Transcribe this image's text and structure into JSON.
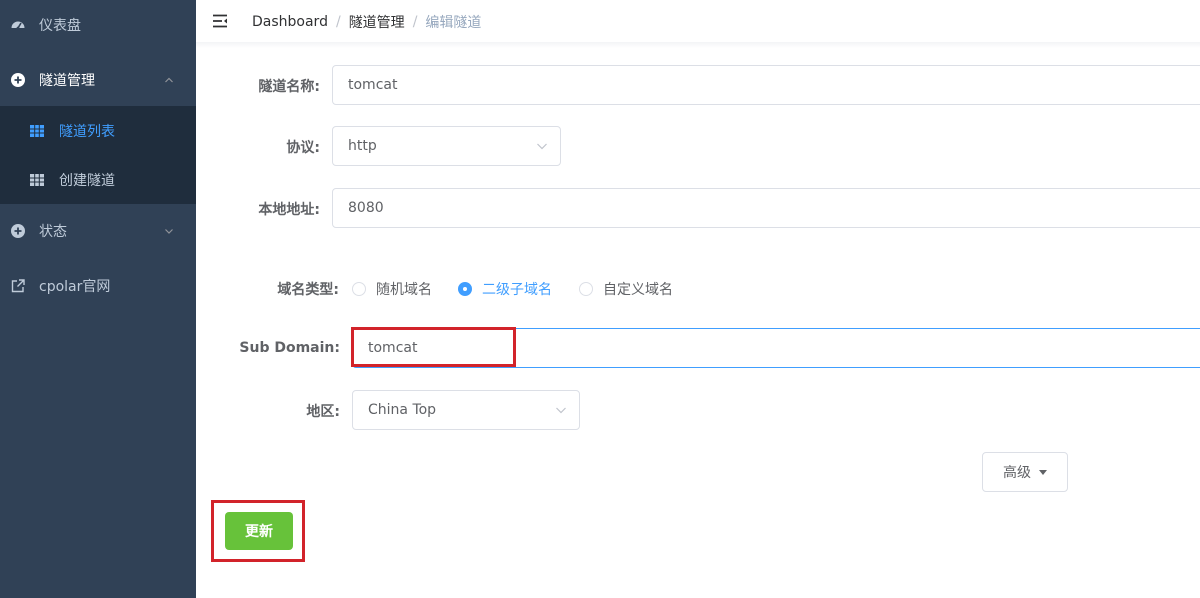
{
  "sidebar": {
    "dashboard_label": "仪表盘",
    "tunnel_mgmt_label": "隧道管理",
    "tunnel_list_label": "隧道列表",
    "create_tunnel_label": "创建隧道",
    "status_label": "状态",
    "website_label": "cpolar官网",
    "active_item": "隧道列表"
  },
  "breadcrumb": {
    "items": [
      "Dashboard",
      "隧道管理",
      "编辑隧道"
    ],
    "separator": "/"
  },
  "form": {
    "tunnel_name_label": "隧道名称:",
    "tunnel_name_value": "tomcat",
    "protocol_label": "协议:",
    "protocol_value": "http",
    "local_addr_label": "本地地址:",
    "local_addr_value": "8080",
    "domain_type_label": "域名类型:",
    "domain_types": [
      "随机域名",
      "二级子域名",
      "自定义域名"
    ],
    "domain_type_selected": "二级子域名",
    "subdomain_label": "Sub Domain:",
    "subdomain_value": "tomcat",
    "region_label": "地区:",
    "region_value": "China Top"
  },
  "buttons": {
    "advanced_label": "高级",
    "update_label": "更新"
  },
  "colors": {
    "sidebar_bg": "#304156",
    "submenu_bg": "#1f2d3d",
    "accent": "#409eff",
    "success": "#67c23a",
    "highlight": "#d2232a"
  }
}
